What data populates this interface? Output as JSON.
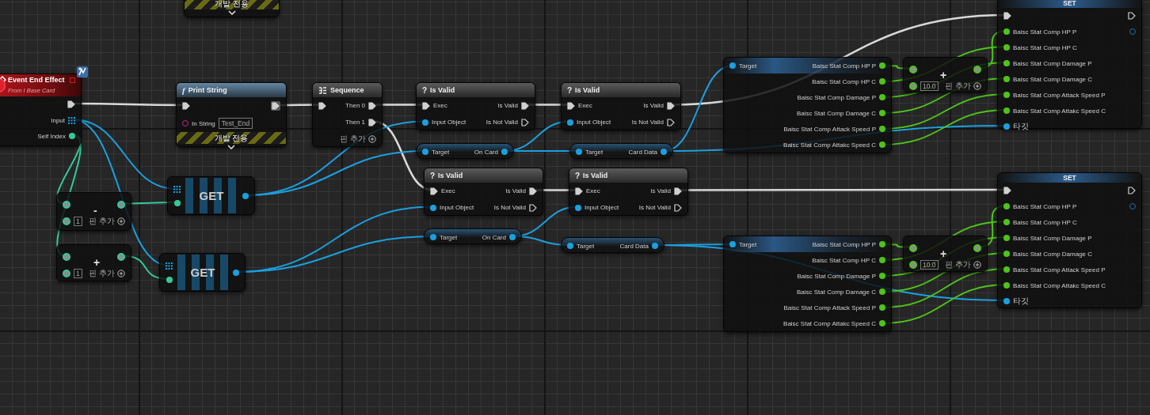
{
  "graph": {
    "nodes": [
      {
        "kind": "dev_only",
        "banner": "개발 전용"
      },
      {
        "kind": "event",
        "title": "Event End Effect",
        "subtitle": "From I Base Card",
        "outputs": [
          "Input",
          "Self Index"
        ]
      },
      {
        "kind": "function",
        "icon": "f",
        "title": "Print String",
        "input": "In String",
        "value": "Test_End",
        "banner": "개발 전용"
      },
      {
        "kind": "sequence",
        "title": "Sequence",
        "outputs": [
          "Then 0",
          "Then 1"
        ],
        "add_pin": "핀 추가"
      },
      {
        "kind": "is_valid",
        "icon": "?",
        "title": "Is Valid",
        "inputs": [
          "Exec",
          "Input Object"
        ],
        "outputs": [
          "Is Valid",
          "Is Not Valid"
        ]
      },
      {
        "kind": "is_valid",
        "icon": "?",
        "title": "Is Valid",
        "inputs": [
          "Exec",
          "Input Object"
        ],
        "outputs": [
          "Is Valid",
          "Is Not Valid"
        ]
      },
      {
        "kind": "getter",
        "input": "Target",
        "output": "On Card"
      },
      {
        "kind": "getter",
        "input": "Target",
        "output": "Card Data"
      },
      {
        "kind": "is_valid",
        "icon": "?",
        "title": "Is Valid",
        "inputs": [
          "Exec",
          "Input Object"
        ],
        "outputs": [
          "Is Valid",
          "Is Not Valid"
        ]
      },
      {
        "kind": "is_valid",
        "icon": "?",
        "title": "Is Valid",
        "inputs": [
          "Exec",
          "Input Object"
        ],
        "outputs": [
          "Is Valid",
          "Is Not Valid"
        ]
      },
      {
        "kind": "getter",
        "input": "Target",
        "output": "On Card"
      },
      {
        "kind": "getter",
        "input": "Target",
        "output": "Card Data"
      },
      {
        "kind": "array_get",
        "title": "GET"
      },
      {
        "kind": "math",
        "operator": "-",
        "value": "1",
        "add_pin": "핀 추가"
      },
      {
        "kind": "math",
        "operator": "+",
        "value": "1",
        "add_pin": "핀 추가"
      },
      {
        "kind": "array_get",
        "title": "GET"
      },
      {
        "kind": "break",
        "input": "Target",
        "outputs": [
          "Baisc Stat Comp HP P",
          "Baisc Stat Comp HP C",
          "Baisc Stat Comp Damage P",
          "Baisc Stat Comp Damage C",
          "Baisc Stat Comp Attack Speed P",
          "Baisc Stat Comp Attakc Speed C"
        ]
      },
      {
        "kind": "math",
        "operator": "+",
        "value": "10.0",
        "add_pin": "핀 추가"
      },
      {
        "kind": "set",
        "title": "SET",
        "inputs": [
          "Baisc Stat Comp HP P",
          "Baisc Stat Comp HP C",
          "Baisc Stat Comp Damage P",
          "Baisc Stat Comp Damage C",
          "Baisc Stat Comp Attack Speed P",
          "Baisc Stat Comp Attakc Speed C",
          "타깃"
        ]
      },
      {
        "kind": "break",
        "input": "Target",
        "outputs": [
          "Baisc Stat Comp HP P",
          "Baisc Stat Comp HP C",
          "Baisc Stat Comp Damage P",
          "Baisc Stat Comp Damage C",
          "Baisc Stat Comp Attack Speed P",
          "Baisc Stat Comp Attakc Speed C"
        ]
      },
      {
        "kind": "math",
        "operator": "+",
        "value": "10.0",
        "add_pin": "핀 추가"
      },
      {
        "kind": "set",
        "title": "SET",
        "inputs": [
          "Baisc Stat Comp HP P",
          "Baisc Stat Comp HP C",
          "Baisc Stat Comp Damage P",
          "Baisc Stat Comp Damage C",
          "Baisc Stat Comp Attack Speed P",
          "Baisc Stat Comp Attakc Speed C",
          "타깃"
        ]
      }
    ]
  }
}
